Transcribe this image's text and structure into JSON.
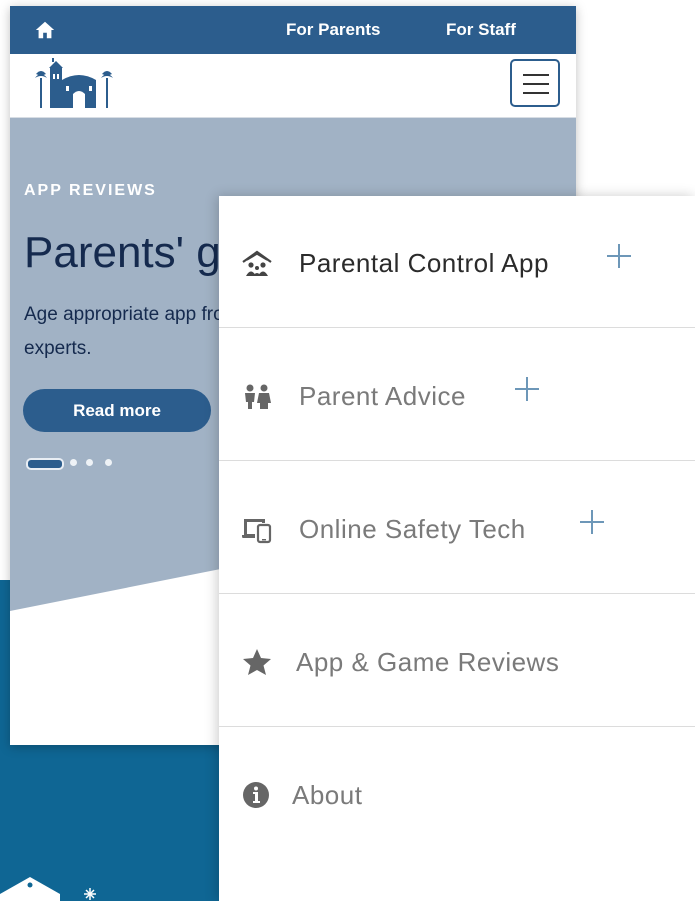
{
  "topbar": {
    "links": [
      "For Parents",
      "For Staff"
    ]
  },
  "hero": {
    "eyebrow": "APP REVIEWS",
    "title": "Parents' g",
    "text": "Age appropriate app from the experts.",
    "button": "Read more",
    "carousel": {
      "slides": 4,
      "active": 1
    }
  },
  "menu": {
    "items": [
      {
        "label": "Parental Control App",
        "icon": "family-house-icon",
        "expandable": true,
        "active": true
      },
      {
        "label": "Parent Advice",
        "icon": "parents-icon",
        "expandable": true,
        "active": false
      },
      {
        "label": "Online Safety Tech",
        "icon": "devices-icon",
        "expandable": true,
        "active": false
      },
      {
        "label": "App & Game Reviews",
        "icon": "star-icon",
        "expandable": false,
        "active": false
      },
      {
        "label": "About",
        "icon": "info-icon",
        "expandable": false,
        "active": false
      }
    ]
  },
  "colors": {
    "brand": "#2c5d8d",
    "hero_bg": "#a1b2c5",
    "accent_plus": "#6d97b8",
    "deep_blue": "#0f6694"
  }
}
